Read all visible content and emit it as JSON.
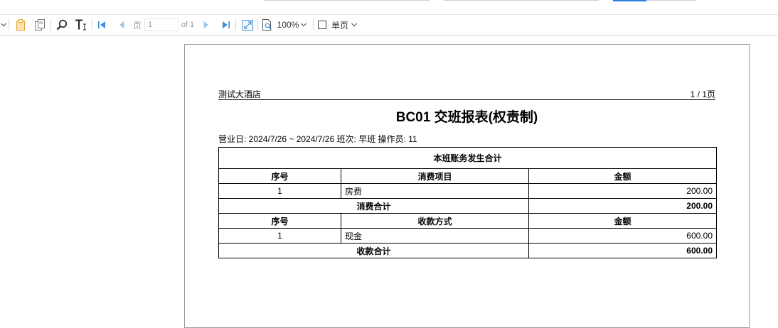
{
  "toolbar": {
    "page_label": "页",
    "page_value": "1",
    "page_of": "of 1",
    "zoom": "100%",
    "view_mode": "单页"
  },
  "report": {
    "hotel": "测试大酒店",
    "page_info": "1 / 1页",
    "title": "BC01 交班报表(权责制)",
    "info_line": "营业日: 2024/7/26 ~ 2024/7/26  班次: 早班  操作员: 11",
    "section_title": "本班账务发生合计",
    "consume": {
      "headers": [
        "序号",
        "消费项目",
        "金额"
      ],
      "rows": [
        {
          "no": "1",
          "item": "房费",
          "amount": "200.00"
        }
      ],
      "total_label": "消费合计",
      "total_amount": "200.00"
    },
    "payment": {
      "headers": [
        "序号",
        "收款方式",
        "金额"
      ],
      "rows": [
        {
          "no": "1",
          "item": "现金",
          "amount": "600.00"
        }
      ],
      "total_label": "收款合计",
      "total_amount": "600.00"
    }
  },
  "colors": {
    "accent": "#2f7fe0",
    "nav_blue": "#3a8fd9",
    "copy_orange": "#e8a33c"
  }
}
